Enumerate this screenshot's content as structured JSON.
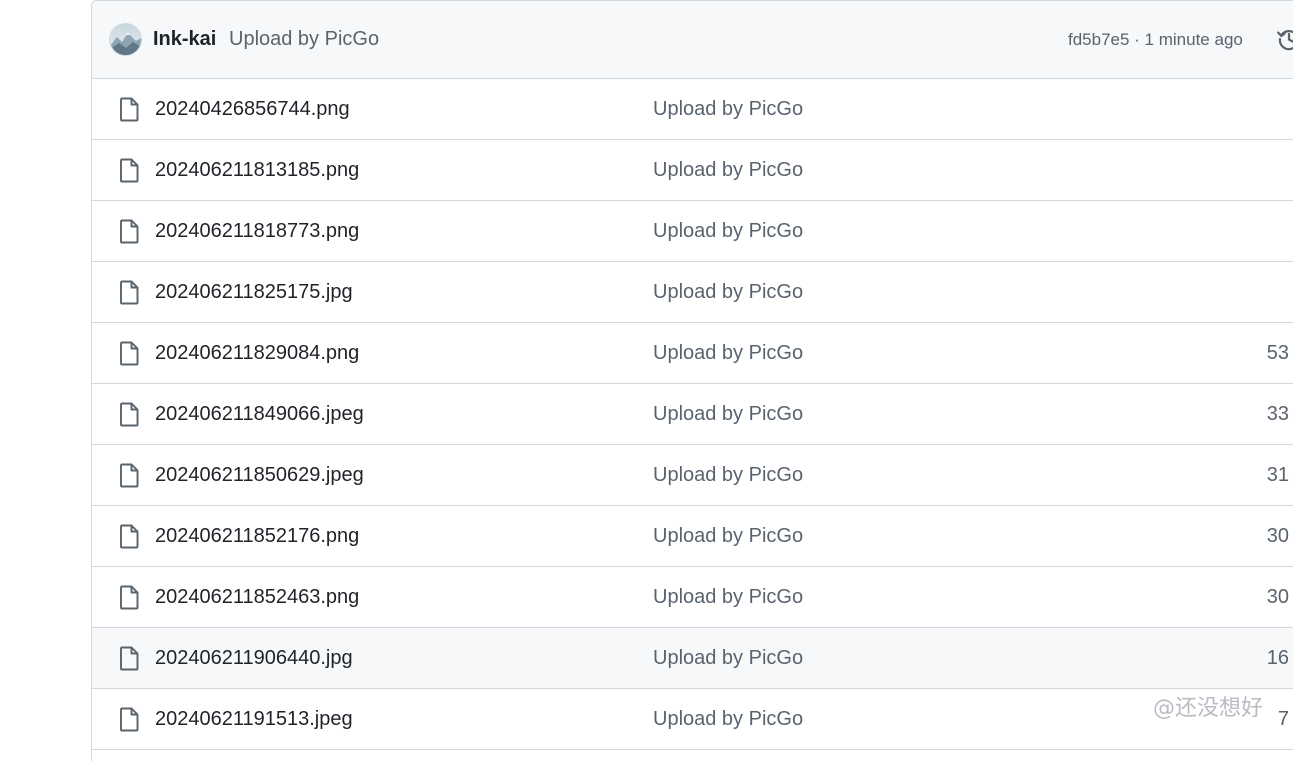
{
  "commit": {
    "author": "Ink-kai",
    "message": "Upload by PicGo",
    "meta": "fd5b7e5 · 1 minute ago",
    "history_icon": "history-icon",
    "avatar_icon": "avatar"
  },
  "files": [
    {
      "name": "20240426856744.png",
      "message": "Upload by PicGo",
      "age": ""
    },
    {
      "name": "202406211813185.png",
      "message": "Upload by PicGo",
      "age": ""
    },
    {
      "name": "202406211818773.png",
      "message": "Upload by PicGo",
      "age": ""
    },
    {
      "name": "202406211825175.jpg",
      "message": "Upload by PicGo",
      "age": ""
    },
    {
      "name": "202406211829084.png",
      "message": "Upload by PicGo",
      "age": "53"
    },
    {
      "name": "202406211849066.jpeg",
      "message": "Upload by PicGo",
      "age": "33"
    },
    {
      "name": "202406211850629.jpeg",
      "message": "Upload by PicGo",
      "age": "31"
    },
    {
      "name": "202406211852176.png",
      "message": "Upload by PicGo",
      "age": "30"
    },
    {
      "name": "202406211852463.png",
      "message": "Upload by PicGo",
      "age": "30"
    },
    {
      "name": "202406211906440.jpg",
      "message": "Upload by PicGo",
      "age": "16"
    },
    {
      "name": "20240621191513.jpeg",
      "message": "Upload by PicGo",
      "age": "7"
    }
  ],
  "hovered_row_index": 9,
  "watermark": "@还没想好",
  "colors": {
    "border": "#d0d7de",
    "header_bg": "#f6f8fa",
    "text_primary": "#1f2328",
    "text_muted": "#59636e"
  }
}
